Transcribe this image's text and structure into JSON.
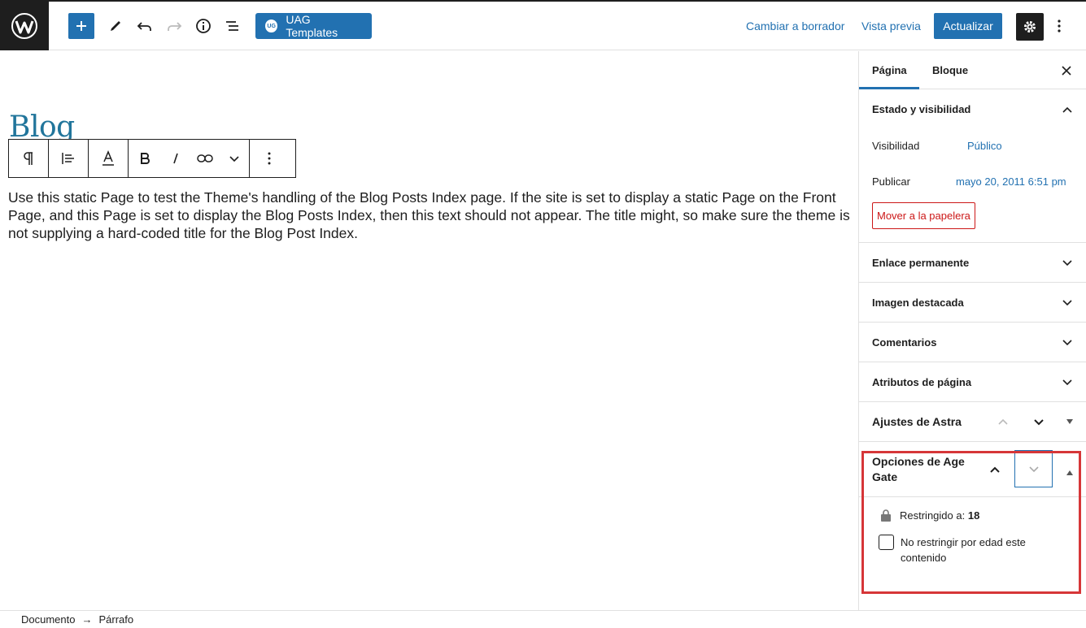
{
  "header": {
    "uag_badge": "UG",
    "uag_templates": "UAG Templates",
    "switch_draft": "Cambiar a borrador",
    "preview": "Vista previa",
    "update": "Actualizar"
  },
  "editor": {
    "title": "Blog",
    "paragraph": "Use this static Page to test the Theme's handling of the Blog Posts Index page. If the site is set to display a static Page on the Front Page, and this Page is set to display the Blog Posts Index, then this text should not appear. The title might, so make sure the theme is not supplying a hard-coded title for the Blog Post Index."
  },
  "sidebar": {
    "tabs": [
      "Página",
      "Bloque"
    ],
    "status_panel": {
      "title": "Estado y visibilidad",
      "visibility_label": "Visibilidad",
      "visibility_value": "Público",
      "publish_label": "Publicar",
      "publish_value": "mayo 20, 2011 6:51 pm",
      "trash": "Mover a la papelera"
    },
    "panels": [
      "Enlace permanente",
      "Imagen destacada",
      "Comentarios",
      "Atributos de página"
    ],
    "astra": "Ajustes de Astra",
    "age_gate": {
      "title": "Opciones de Age Gate",
      "restricted_label": "Restringido a:",
      "restricted_value": "18",
      "checkbox_label": "No restringir por edad este contenido"
    }
  },
  "footer": {
    "crumbs": [
      "Documento",
      "Párrafo"
    ]
  },
  "colors": {
    "accent": "#2271b1",
    "danger": "#cc1818",
    "highlight": "#d63638"
  }
}
